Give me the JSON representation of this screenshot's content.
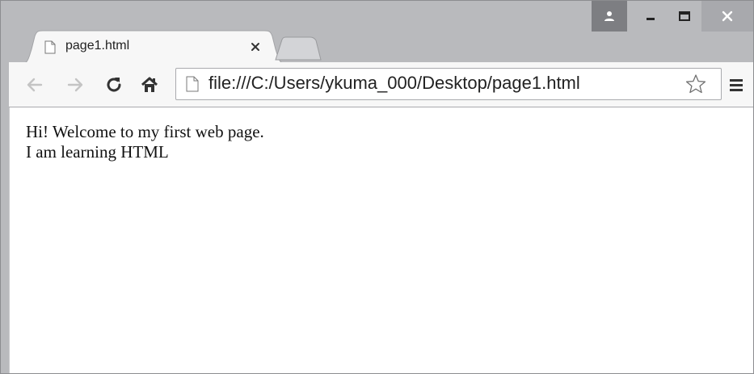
{
  "window": {
    "controls": {
      "profile_icon": "profile-icon",
      "minimize_icon": "minimize-icon",
      "maximize_icon": "maximize-icon",
      "close_icon": "close-icon"
    }
  },
  "tabs": [
    {
      "title": "page1.html",
      "active": true,
      "icon": "page-icon",
      "close_icon": "close-icon"
    }
  ],
  "toolbar": {
    "back_icon": "back-arrow-icon",
    "forward_icon": "forward-arrow-icon",
    "reload_icon": "reload-icon",
    "home_icon": "home-icon",
    "address": "file:///C:/Users/ykuma_000/Desktop/page1.html",
    "bookmark_icon": "star-icon",
    "menu_icon": "hamburger-menu-icon"
  },
  "page": {
    "lines": [
      "Hi! Welcome to my first web page.",
      "I am learning HTML"
    ]
  },
  "colors": {
    "frame": "#b9babd",
    "toolbar": "#f7f7f7",
    "profile_button": "#7d7e82",
    "close_button": "#a8a9ad"
  }
}
